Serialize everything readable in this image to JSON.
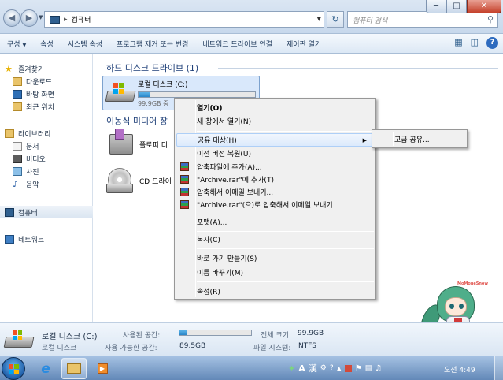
{
  "address": {
    "path_label": "컴퓨터",
    "search_placeholder": "컴퓨터 검색"
  },
  "window_controls": {
    "minimize": "─",
    "maximize": "□",
    "close": "✕"
  },
  "toolbar": {
    "organize": "구성",
    "properties": "속성",
    "system_properties": "시스템 속성",
    "uninstall": "프로그램 제거 또는 변경",
    "map_drive": "네트워크 드라이브 연결",
    "control_panel": "제어판 열기"
  },
  "nav": {
    "favorites": "즐겨찾기",
    "downloads": "다운로드",
    "desktop": "바탕 화면",
    "recent": "최근 위치",
    "libraries": "라이브러리",
    "documents": "문서",
    "videos": "비디오",
    "pictures": "사진",
    "music": "음악",
    "computer": "컴퓨터",
    "network": "네트워크"
  },
  "content": {
    "hdd_group": "하드 디스크 드라이브 (1)",
    "removable_group": "이동식 미디어 장",
    "drive_c": {
      "name": "로컬 디스크 (C:)",
      "free": "99.9GB 중",
      "used_fraction": 0.1
    },
    "floppy": "플로피 디",
    "cd": "CD 드라이"
  },
  "context_menu": {
    "items": [
      "열기(O)",
      "새 창에서 열기(N)",
      "공유 대상(H)",
      "이전 버전 복원(U)",
      "압축파일에 추가(A)...",
      "\"Archive.rar\"에 추가(T)",
      "압축해서 이메일 보내기...",
      "\"Archive.rar\"(으)로 압축해서 이메일 보내기",
      "포맷(A)...",
      "복사(C)",
      "바로 가기 만들기(S)",
      "이름 바꾸기(M)",
      "속성(R)"
    ],
    "submenu": [
      "고급 공유..."
    ]
  },
  "mascot_text": "MoMoneSnow",
  "details": {
    "name": "로컬 디스크 (C:)",
    "type": "로컬 디스크",
    "used_label": "사용된 공간:",
    "free_label": "사용 가능한 공간:",
    "free_value": "89.5GB",
    "total_label": "전체 크기:",
    "total_value": "99.9GB",
    "fs_label": "파일 시스템:",
    "fs_value": "NTFS",
    "used_fraction": 0.1
  },
  "taskbar": {
    "clock": "오전 4:49",
    "ime_a": "A",
    "ime_han": "漢"
  },
  "colors": {
    "win_red": "#f25022",
    "win_green": "#7fba00",
    "win_blue": "#00a4ef",
    "win_yellow": "#ffb900"
  }
}
